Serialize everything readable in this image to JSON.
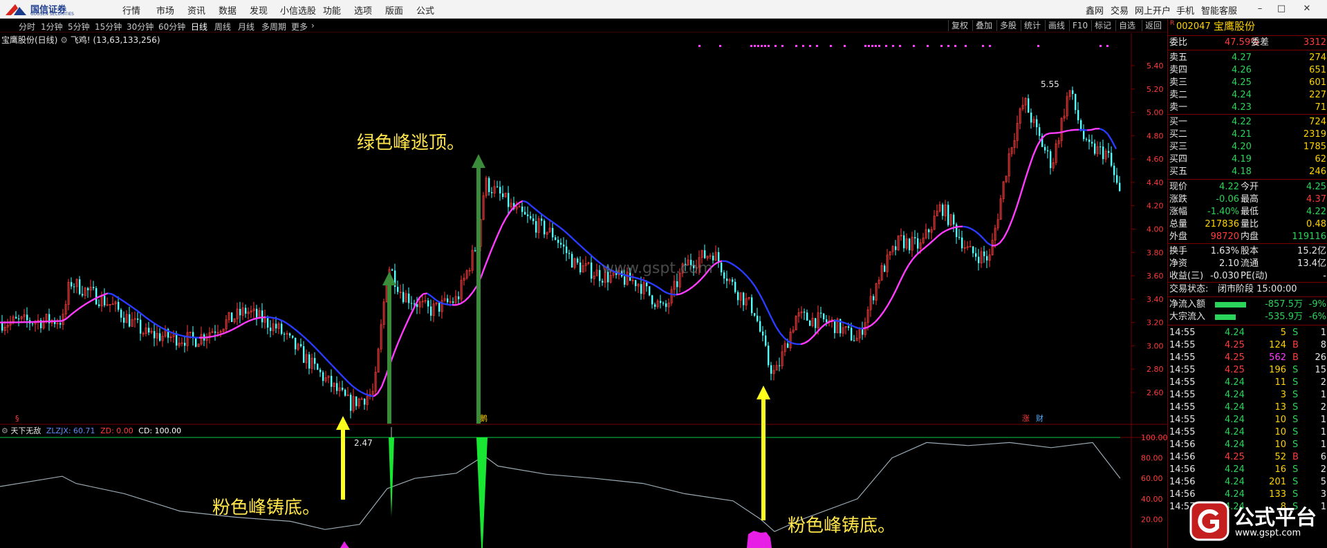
{
  "app": {
    "logo_name": "国信证券",
    "logo_sub": "GUOSEN SECURITIES"
  },
  "menu": {
    "items": [
      "行情",
      "市场",
      "资讯",
      "数据",
      "发现",
      "小信选股",
      "功能",
      "选项",
      "版面",
      "公式"
    ],
    "right": [
      "鑫网",
      "交易",
      "网上开户",
      "手机",
      "智能客服"
    ]
  },
  "periods": {
    "items": [
      "分时",
      "1分钟",
      "5分钟",
      "15分钟",
      "30分钟",
      "60分钟",
      "日线",
      "周线",
      "月线",
      "多周期",
      "更多"
    ],
    "active": "日线"
  },
  "toolbar": {
    "items": [
      "复权",
      "叠加",
      "多股",
      "统计",
      "画线",
      "F10",
      "标记",
      "自选",
      "返回"
    ]
  },
  "chart": {
    "title": "宝鹰股份(日线)",
    "ind_name": "飞鸡!",
    "ind_params": "(13,63,133,256)",
    "high_label": "5.55",
    "low_label": "2.47",
    "watermark": "www.gspt.com",
    "marker_zhang": "涨",
    "marker_cai": "财",
    "marker_mid": "鹅",
    "price_axis": [
      "5.40",
      "5.20",
      "5.00",
      "4.80",
      "4.60",
      "4.40",
      "4.20",
      "4.00",
      "3.80",
      "3.60",
      "3.40",
      "3.20",
      "3.00",
      "2.80",
      "2.60"
    ],
    "ind_axis": [
      "100.00",
      "80.00",
      "60.00",
      "40.00",
      "20.00"
    ]
  },
  "indicator": {
    "name": "天下无敌",
    "zlzjx_label": "ZLZJX: 60.71",
    "zd_label": "ZD: 0.00",
    "cd_label": "CD: 100.00"
  },
  "annotations": {
    "top": "绿色峰逃顶。",
    "bottom_left": "粉色峰铸底。",
    "bottom_right": "粉色峰铸底。"
  },
  "quote": {
    "code": "002047",
    "name": "宝鹰股份",
    "r_mark": "R",
    "weibi_label": "委比",
    "weibi": "47.59%",
    "weicha_label": "委差",
    "weicha": "3312",
    "asks": [
      {
        "label": "卖五",
        "price": "4.27",
        "vol": "274"
      },
      {
        "label": "卖四",
        "price": "4.26",
        "vol": "651"
      },
      {
        "label": "卖三",
        "price": "4.25",
        "vol": "601"
      },
      {
        "label": "卖二",
        "price": "4.24",
        "vol": "227"
      },
      {
        "label": "卖一",
        "price": "4.23",
        "vol": "71"
      }
    ],
    "bids": [
      {
        "label": "买一",
        "price": "4.22",
        "vol": "724"
      },
      {
        "label": "买二",
        "price": "4.21",
        "vol": "2319"
      },
      {
        "label": "买三",
        "price": "4.20",
        "vol": "1785"
      },
      {
        "label": "买四",
        "price": "4.19",
        "vol": "62"
      },
      {
        "label": "买五",
        "price": "4.18",
        "vol": "246"
      }
    ],
    "stats": [
      {
        "l1": "现价",
        "v1": "4.22",
        "c1": "green",
        "l2": "今开",
        "v2": "4.25",
        "c2": "green"
      },
      {
        "l1": "涨跌",
        "v1": "-0.06",
        "c1": "green",
        "l2": "最高",
        "v2": "4.37",
        "c2": "red"
      },
      {
        "l1": "涨幅",
        "v1": "-1.40%",
        "c1": "green",
        "l2": "最低",
        "v2": "4.22",
        "c2": "green"
      },
      {
        "l1": "总量",
        "v1": "217836",
        "c1": "yellow",
        "l2": "量比",
        "v2": "0.48",
        "c2": "yellow"
      },
      {
        "l1": "外盘",
        "v1": "98720",
        "c1": "red",
        "l2": "内盘",
        "v2": "119116",
        "c2": "green"
      }
    ],
    "stats2": [
      {
        "l1": "换手",
        "v1": "1.63%",
        "l2": "股本",
        "v2": "15.2亿"
      },
      {
        "l1": "净资",
        "v1": "2.10",
        "l2": "流通",
        "v2": "13.4亿"
      },
      {
        "l1": "收益(三)",
        "v1": "-0.030",
        "l2": "PE(动)",
        "v2": "-"
      }
    ],
    "trade_state_label": "交易状态:",
    "trade_state": "闭市阶段 15:00:00",
    "flows": [
      {
        "label": "净流入额",
        "value": "-857.5万",
        "pct": "-9%",
        "bar": 0.45
      },
      {
        "label": "大宗流入",
        "value": "-535.9万",
        "pct": "-6%",
        "bar": 0.3
      }
    ],
    "ticks": [
      {
        "t": "14:55",
        "p": "4.24",
        "v": "5",
        "bs": "S",
        "n": "1"
      },
      {
        "t": "14:55",
        "p": "4.25",
        "v": "124",
        "bs": "B",
        "n": "8"
      },
      {
        "t": "14:55",
        "p": "4.25",
        "v": "562",
        "bs": "B",
        "n": "26"
      },
      {
        "t": "14:55",
        "p": "4.25",
        "v": "196",
        "bs": "S",
        "n": "15"
      },
      {
        "t": "14:55",
        "p": "4.24",
        "v": "11",
        "bs": "S",
        "n": "2"
      },
      {
        "t": "14:55",
        "p": "4.24",
        "v": "3",
        "bs": "S",
        "n": "1"
      },
      {
        "t": "14:55",
        "p": "4.24",
        "v": "13",
        "bs": "S",
        "n": "2"
      },
      {
        "t": "14:55",
        "p": "4.24",
        "v": "10",
        "bs": "S",
        "n": "1"
      },
      {
        "t": "14:55",
        "p": "4.24",
        "v": "10",
        "bs": "S",
        "n": "1"
      },
      {
        "t": "14:56",
        "p": "4.24",
        "v": "10",
        "bs": "S",
        "n": "1"
      },
      {
        "t": "14:56",
        "p": "4.25",
        "v": "52",
        "bs": "B",
        "n": "6"
      },
      {
        "t": "14:56",
        "p": "4.24",
        "v": "16",
        "bs": "S",
        "n": "2"
      },
      {
        "t": "14:56",
        "p": "4.24",
        "v": "201",
        "bs": "S",
        "n": "5"
      },
      {
        "t": "14:56",
        "p": "4.24",
        "v": "133",
        "bs": "S",
        "n": "3"
      },
      {
        "t": "14:57",
        "p": "4.24",
        "v": "8",
        "bs": "S",
        "n": "1"
      }
    ]
  },
  "brand": {
    "name": "公式平台",
    "url": "www.gspt.com"
  }
}
